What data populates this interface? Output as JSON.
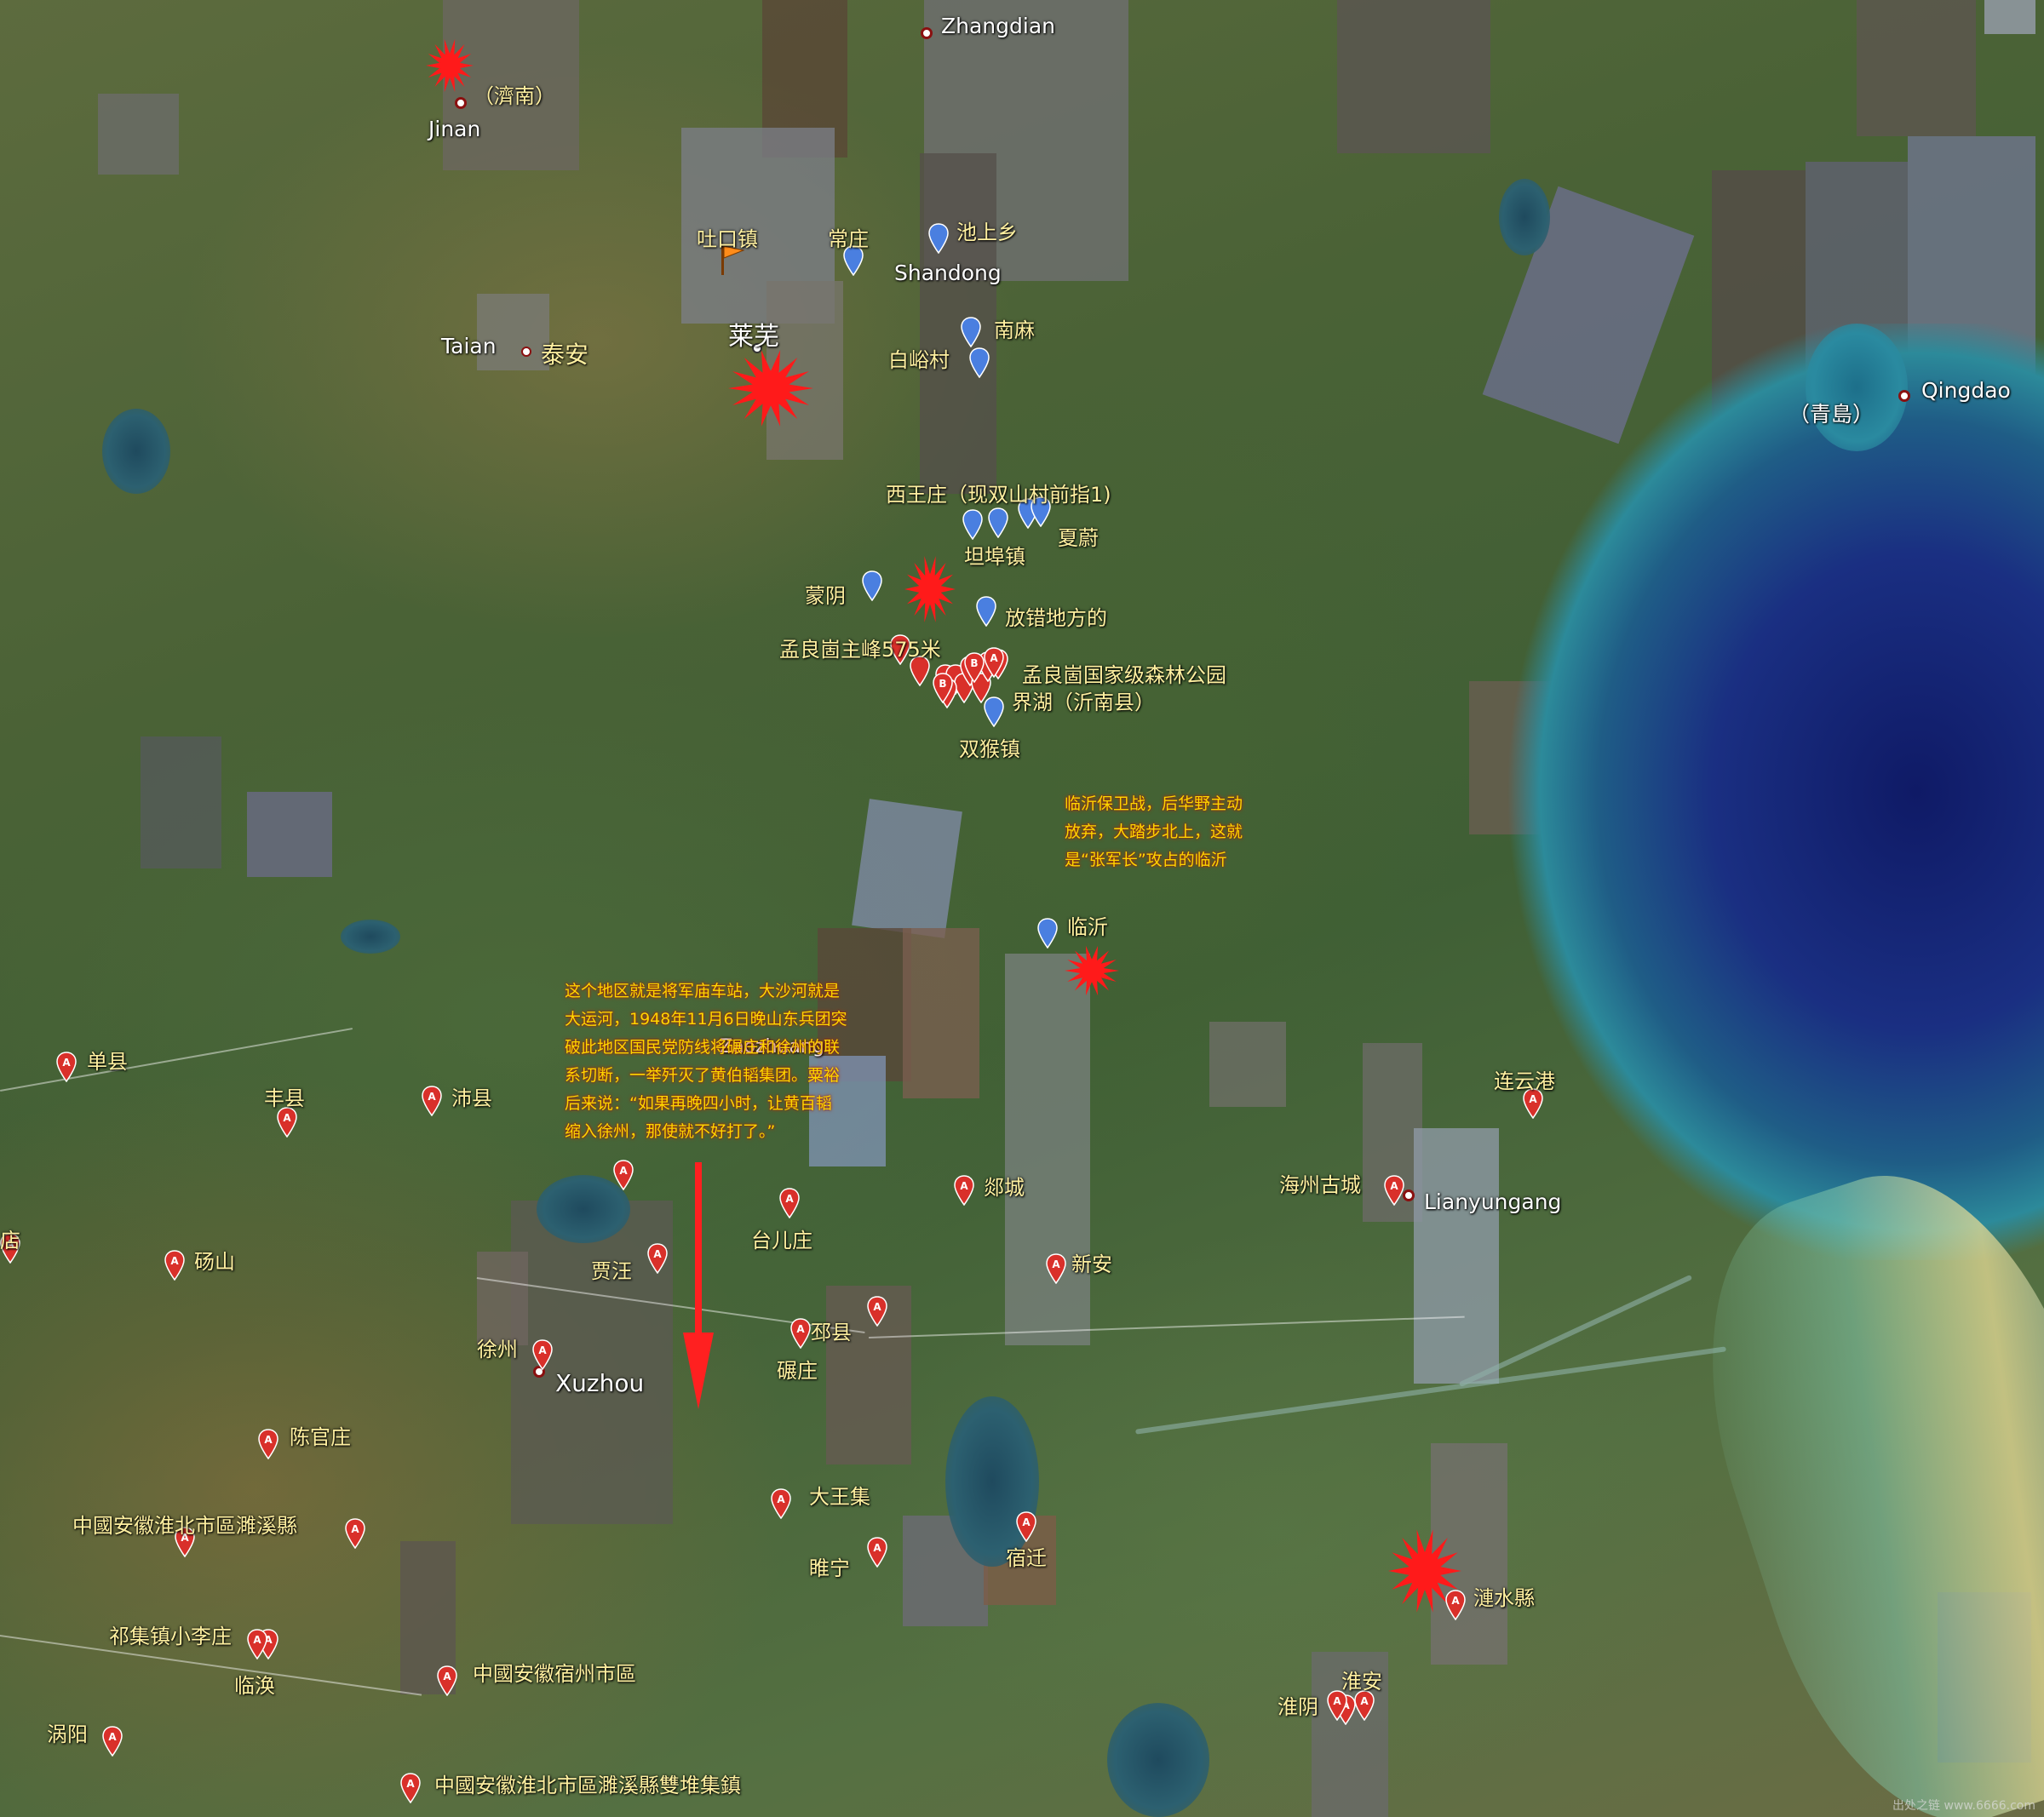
{
  "map": {
    "city_labels": [
      {
        "id": "zhangdian",
        "text": "Zhangdian"
      },
      {
        "id": "jinan",
        "text": "Jinan"
      },
      {
        "id": "jinan_cn",
        "text": "（濟南）"
      },
      {
        "id": "taian",
        "text": "Taian"
      },
      {
        "id": "taian_cn",
        "text": "泰安"
      },
      {
        "id": "shandong",
        "text": "Shandong"
      },
      {
        "id": "qingdao",
        "text": "Qingdao"
      },
      {
        "id": "qingdao_cn",
        "text": "（青島）"
      },
      {
        "id": "laiwu",
        "text": "莱芜"
      },
      {
        "id": "xuzhou",
        "text": "Xuzhou"
      },
      {
        "id": "lianyungang",
        "text": "Lianyungang"
      },
      {
        "id": "zaozhuang",
        "text": "Zaozhuang"
      }
    ],
    "place_labels": [
      {
        "id": "tukouzhen",
        "text": "吐口镇"
      },
      {
        "id": "changzhuang",
        "text": "常庄"
      },
      {
        "id": "chishangxiang",
        "text": "池上乡"
      },
      {
        "id": "nanma",
        "text": "南麻"
      },
      {
        "id": "bailuocun",
        "text": "白峪村"
      },
      {
        "id": "xiwangzhuang",
        "text": "西王庄（现双山村前指1)"
      },
      {
        "id": "xiawei",
        "text": "夏蔚"
      },
      {
        "id": "tanbuzhen",
        "text": "坦埠镇"
      },
      {
        "id": "mengyin",
        "text": "蒙阴"
      },
      {
        "id": "fangcuo",
        "text": "放错地方的"
      },
      {
        "id": "menglianggu_peak",
        "text": "孟良崮主峰575米"
      },
      {
        "id": "menglianggu_park",
        "text": "孟良崮国家级森林公园"
      },
      {
        "id": "jiehu",
        "text": "界湖（沂南县）"
      },
      {
        "id": "shuanghouzhen",
        "text": "双猴镇"
      },
      {
        "id": "linyi",
        "text": "临沂"
      },
      {
        "id": "shanxian",
        "text": "单县"
      },
      {
        "id": "fengxian",
        "text": "丰县"
      },
      {
        "id": "peixian",
        "text": "沛县"
      },
      {
        "id": "dian",
        "text": "店"
      },
      {
        "id": "dangshan",
        "text": "砀山"
      },
      {
        "id": "jiawang",
        "text": "贾汪"
      },
      {
        "id": "taierzhuang",
        "text": "台儿庄"
      },
      {
        "id": "tancheng",
        "text": "郯城"
      },
      {
        "id": "xinan",
        "text": "新安"
      },
      {
        "id": "lianyungang_port",
        "text": "连云港"
      },
      {
        "id": "haizhou",
        "text": "海州古城"
      },
      {
        "id": "xuzhou_cn",
        "text": "徐州"
      },
      {
        "id": "pixian",
        "text": "邳县"
      },
      {
        "id": "nianzhuang",
        "text": "碾庄"
      },
      {
        "id": "chenguanzhuang",
        "text": "陈官庄"
      },
      {
        "id": "dawangji",
        "text": "大王集"
      },
      {
        "id": "suiningxian",
        "text": "睢宁"
      },
      {
        "id": "suqian",
        "text": "宿迁"
      },
      {
        "id": "lianshui",
        "text": "漣水縣"
      },
      {
        "id": "huaibei_suixi",
        "text": "中國安徽淮北市區濉溪縣"
      },
      {
        "id": "qijizhen",
        "text": "祁集镇小李庄"
      },
      {
        "id": "linhuan",
        "text": "临涣"
      },
      {
        "id": "suzhou_ah",
        "text": "中國安徽宿州市區"
      },
      {
        "id": "guoyang",
        "text": "涡阳"
      },
      {
        "id": "huaian",
        "text": "淮安"
      },
      {
        "id": "huaiyin",
        "text": "淮阴"
      },
      {
        "id": "shuangdui",
        "text": "中國安徽淮北市區濉溪縣雙堆集鎮"
      }
    ],
    "annotations": {
      "linyi_note": [
        "临沂保卫战，后华野主动",
        "放弃，大踏步北上，这就",
        "是“张军长”攻占的临沂"
      ],
      "zaozhuang_note": [
        "这个地区就是将军庙车站，大沙河就是",
        "大运河，1948年11月6日晚山东兵团突",
        "破此地区国民党防线将碾庄和徐州的联",
        "系切断，一举歼灭了黄伯韬集团。粟裕",
        "后来说：“如果再晚四小时，让黄百韬",
        "缩入徐州，那使就不好打了。”"
      ]
    },
    "marker_letters": {
      "a": "A",
      "b": "B",
      "c": "C"
    },
    "watermark": "出处之链 www.6666.com",
    "colors": {
      "red_marker": "#d9302a",
      "blue_marker": "#4a7fe0",
      "dark_blue_marker": "#2b4f9e",
      "burst": "#ff1a1a",
      "label": "#fff0a0",
      "note": "#ffd600"
    },
    "icons": [
      "red-placemark-icon",
      "blue-placemark-icon",
      "explosion-icon",
      "orange-flag-icon",
      "city-dot-icon",
      "red-arrow-icon"
    ]
  }
}
